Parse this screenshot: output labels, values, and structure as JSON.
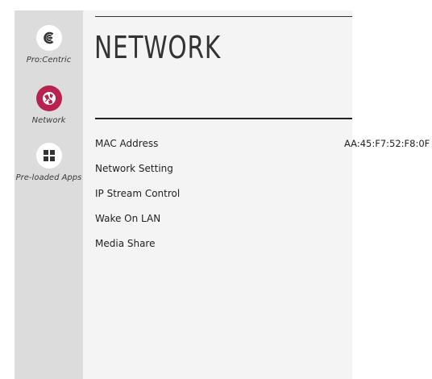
{
  "sidebar": {
    "items": [
      {
        "label": "Pro:Centric",
        "icon": "procentric-icon",
        "active": false
      },
      {
        "label": "Network",
        "icon": "network-globe-icon",
        "active": true
      },
      {
        "label": "Pre-loaded Apps",
        "icon": "apps-grid-icon",
        "active": false
      }
    ]
  },
  "page": {
    "title": "NETWORK"
  },
  "menu": {
    "items": [
      {
        "label": "MAC Address",
        "value": "AA:45:F7:52:F8:0F"
      },
      {
        "label": "Network Setting"
      },
      {
        "label": "IP Stream Control"
      },
      {
        "label": "Wake On LAN"
      },
      {
        "label": "Media Share"
      }
    ]
  },
  "colors": {
    "sidebar_bg": "#dcdcdd",
    "content_bg": "#f4f4f4",
    "accent": "#b8224e",
    "text": "#222222"
  }
}
